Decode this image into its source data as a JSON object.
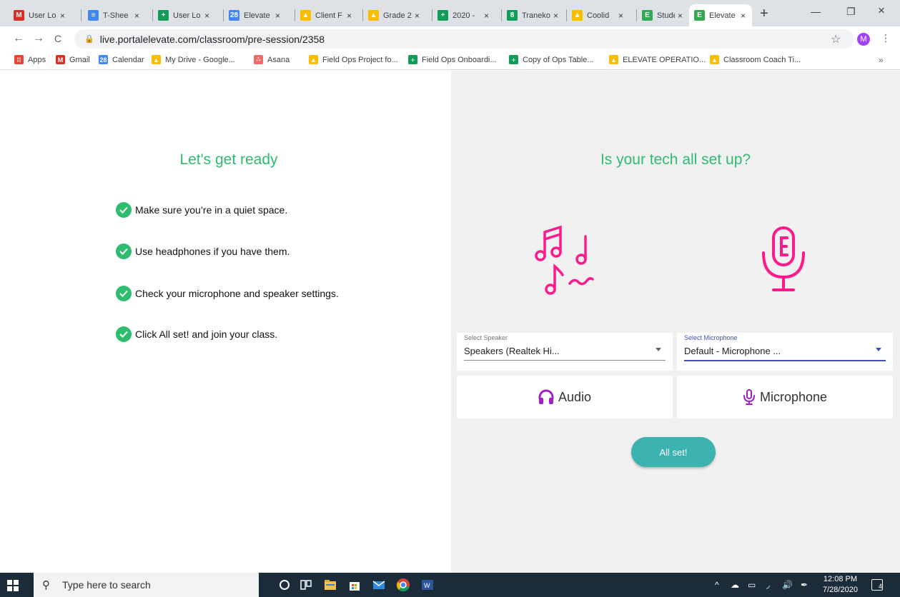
{
  "browser": {
    "tabs": [
      {
        "title": "User Lo",
        "icon": "gmail-icon",
        "color": "#d93025",
        "glyph": "M"
      },
      {
        "title": "T-Shee",
        "icon": "docs-icon",
        "color": "#4285f4",
        "glyph": "≡"
      },
      {
        "title": "User Lo",
        "icon": "sheets-icon",
        "color": "#0f9d58",
        "glyph": "+"
      },
      {
        "title": "Elevate",
        "icon": "calendar-icon",
        "color": "#4285f4",
        "glyph": "28"
      },
      {
        "title": "Client F",
        "icon": "drive-icon",
        "color": "#fbbc04",
        "glyph": "▲"
      },
      {
        "title": "Grade 2",
        "icon": "drive-icon",
        "color": "#fbbc04",
        "glyph": "▲"
      },
      {
        "title": "2020 -",
        "icon": "sheets-icon",
        "color": "#0f9d58",
        "glyph": "+"
      },
      {
        "title": "Traneko",
        "icon": "translate-icon",
        "color": "#0f9d58",
        "glyph": "8"
      },
      {
        "title": "Coolid",
        "icon": "drive-icon",
        "color": "#fbbc04",
        "glyph": "▲"
      },
      {
        "title": "Studen",
        "icon": "forms-icon",
        "color": "#34a853",
        "glyph": "E"
      },
      {
        "title": "Elevate",
        "icon": "forms-icon",
        "color": "#34a853",
        "glyph": "E"
      }
    ],
    "close_glyph": "×",
    "new_tab_glyph": "+",
    "minimize_glyph": "—",
    "restore_glyph": "❐",
    "close_window_glyph": "×",
    "back_glyph": "←",
    "forward_glyph": "→",
    "reload_glyph": "C",
    "lock_glyph": "🔒",
    "url": "live.portalelevate.com/classroom/pre-session/2358",
    "star_glyph": "☆",
    "profile_initial": "M",
    "menu_glyph": "⋮",
    "bookmarks": [
      {
        "label": "Apps",
        "icon": "apps-grid-icon",
        "color": "#ea4335",
        "glyph": "⁞⁞"
      },
      {
        "label": "Gmail",
        "icon": "gmail-icon",
        "color": "#d93025",
        "glyph": "M"
      },
      {
        "label": "Calendar",
        "icon": "calendar-icon",
        "color": "#4285f4",
        "glyph": "28"
      },
      {
        "label": "My Drive - Google...",
        "icon": "drive-icon",
        "color": "#fbbc04",
        "glyph": "▲"
      },
      {
        "label": "Asana",
        "icon": "asana-icon",
        "color": "#f06a6a",
        "glyph": "∴"
      },
      {
        "label": "Field Ops Project fo...",
        "icon": "drive-icon",
        "color": "#fbbc04",
        "glyph": "▲"
      },
      {
        "label": "Field Ops Onboardi...",
        "icon": "sheets-icon",
        "color": "#0f9d58",
        "glyph": "+"
      },
      {
        "label": "Copy of Ops Table...",
        "icon": "sheets-icon",
        "color": "#0f9d58",
        "glyph": "+"
      },
      {
        "label": "ELEVATE OPERATIO...",
        "icon": "drive-icon",
        "color": "#fbbc04",
        "glyph": "▲"
      },
      {
        "label": "Classroom Coach Ti...",
        "icon": "drive-icon",
        "color": "#fbbc04",
        "glyph": "▲"
      }
    ],
    "bookmarks_more_glyph": "»"
  },
  "left_panel": {
    "title": "Let's get ready",
    "checklist": [
      "Make sure you’re in a quiet space.",
      "Use headphones if you have them.",
      "Check your microphone and speaker settings.",
      "Click All set! and join your class."
    ]
  },
  "right_panel": {
    "title": "Is your tech all set up?",
    "speaker_select": {
      "label": "Select Speaker",
      "value": "Speakers (Realtek Hi..."
    },
    "microphone_select": {
      "label": "Select Microphone",
      "value": "Default - Microphone ..."
    },
    "audio_button": "Audio",
    "microphone_button": "Microphone",
    "all_set_button": "All set!"
  },
  "colors": {
    "accent_green": "#2ebc6e",
    "icon_pink": "#ff1a8c",
    "icon_purple": "#a020c8",
    "button_teal": "#3cb3b1"
  },
  "taskbar": {
    "search_placeholder": "Type here to search",
    "search_glyph": "⚲",
    "time": "12:08 PM",
    "date": "7/28/2020",
    "notification_count": "4",
    "tray_glyphs": [
      "^",
      "☁",
      "▭",
      "◞",
      "🔊",
      "✒"
    ]
  }
}
